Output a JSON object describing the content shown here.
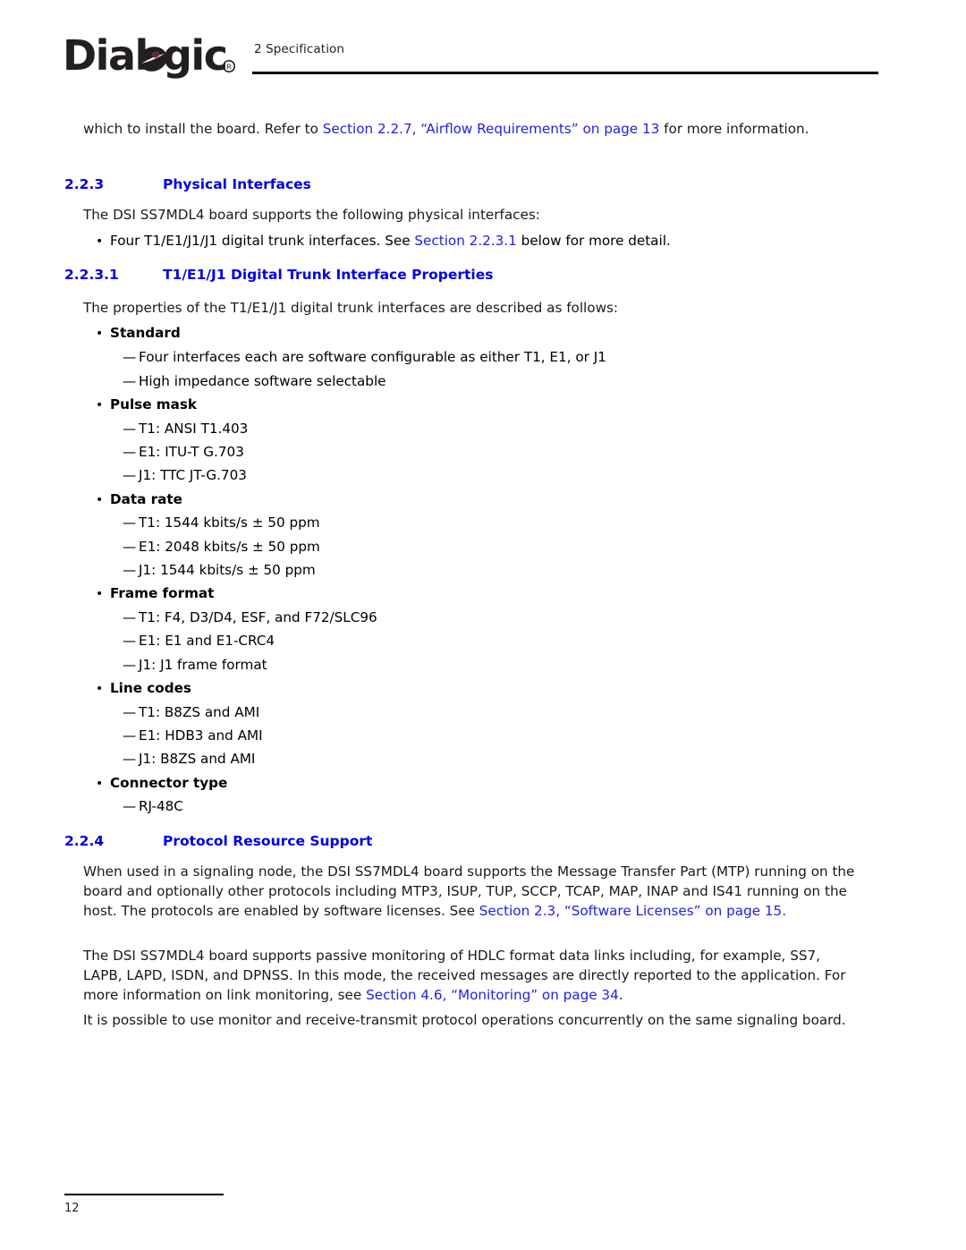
{
  "header": {
    "logo_text": "Dialogic",
    "logo_registered_mark": "®",
    "running_head": "2 Specification"
  },
  "footer": {
    "page_number": "12"
  },
  "colors": {
    "heading_blue": "#0000E2",
    "link_blue": "#2222DD",
    "body_text": "#1A1A1A",
    "rule_black": "#000000"
  },
  "body": {
    "intro_paragraph": {
      "before_link": "which to install the board. Refer to ",
      "link": "Section 2.2.7, “Airflow Requirements” on page 13",
      "after_link": " for more information."
    },
    "section_223": {
      "number": "2.2.3",
      "title": "Physical Interfaces",
      "lead_in": "The DSI SS7MDL4 board supports the following physical interfaces:",
      "bullet": {
        "before_link": "Four T1/E1/J1/J1 digital trunk interfaces. See ",
        "link": "Section 2.2.3.1",
        "after_link": " below for more detail."
      }
    },
    "section_2231": {
      "number": "2.2.3.1",
      "title": "T1/E1/J1 Digital Trunk Interface Properties",
      "lead_in": "The properties of the T1/E1/J1 digital trunk interfaces are described as follows:",
      "properties": [
        {
          "label": "Standard",
          "items": [
            "Four interfaces each are software configurable as either T1, E1, or J1",
            "High impedance software selectable"
          ]
        },
        {
          "label": "Pulse mask",
          "items": [
            "T1: ANSI T1.403",
            "E1: ITU-T G.703",
            "J1: TTC JT-G.703"
          ]
        },
        {
          "label": "Data rate",
          "items": [
            "T1: 1544 kbits/s ± 50 ppm",
            "E1: 2048 kbits/s ± 50 ppm",
            "J1: 1544 kbits/s ± 50 ppm"
          ]
        },
        {
          "label": "Frame format",
          "items": [
            "T1: F4, D3/D4, ESF, and F72/SLC96",
            "E1: E1 and E1-CRC4",
            "J1: J1 frame format"
          ]
        },
        {
          "label": "Line codes",
          "items": [
            "T1: B8ZS and AMI",
            "E1: HDB3 and AMI",
            "J1: B8ZS and AMI"
          ]
        },
        {
          "label": "Connector type",
          "items": [
            "RJ-48C"
          ]
        }
      ]
    },
    "section_224": {
      "number": "2.2.4",
      "title": "Protocol Resource Support",
      "paragraph_1": {
        "before_link": "When used in a signaling node, the DSI SS7MDL4 board supports the Message Transfer Part (MTP) running on the board and optionally other protocols including MTP3, ISUP, TUP, SCCP, TCAP, MAP, INAP and IS41 running on the host. The protocols are enabled by software licenses. See ",
        "link": "Section 2.3, “Software Licenses” on page 15",
        "after_link": "."
      },
      "paragraph_2": {
        "before_link": "The DSI SS7MDL4 board supports passive monitoring of HDLC format data links including, for example, SS7, LAPB, LAPD, ISDN, and DPNSS. In this mode, the received messages are directly reported to the application. For more information on link monitoring, see ",
        "link": "Section 4.6, “Monitoring” on page 34",
        "after_link": "."
      },
      "paragraph_3": "It is possible to use monitor and receive-transmit protocol operations concurrently on the same signaling board."
    }
  },
  "glyphs": {
    "bullet": "•",
    "em_dash": "—"
  }
}
